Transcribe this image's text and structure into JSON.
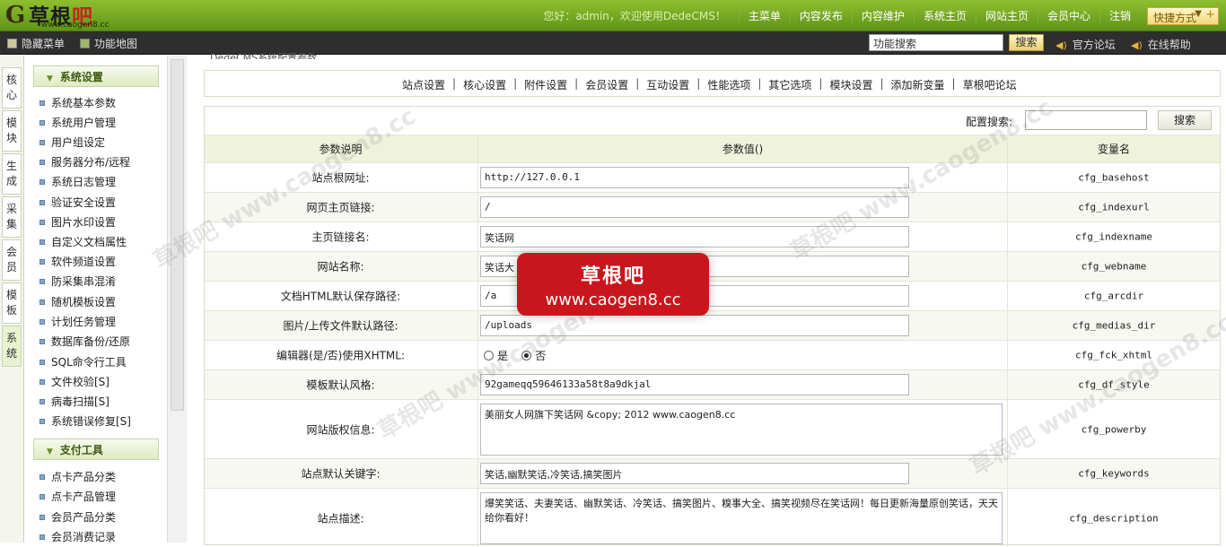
{
  "topbar": {
    "logo_name": "草根",
    "logo_name_red": "吧",
    "logo_url": "www.caogen8.cc",
    "welcome": "您好：admin，欢迎使用DedeCMS！",
    "links": [
      "主菜单",
      "内容发布",
      "内容维护",
      "系统主页",
      "网站主页",
      "会员中心",
      "注销"
    ],
    "quick_label": "快捷方式"
  },
  "subbar": {
    "hide_menu": "隐藏菜单",
    "function_map": "功能地图",
    "search_value": "功能搜索",
    "search_button": "搜索",
    "official_forum": "官方论坛",
    "online_help": "在线帮助"
  },
  "vtabs": [
    "核心",
    "模块",
    "生成",
    "采集",
    "会员",
    "模板",
    "系统"
  ],
  "leftmenu": {
    "group1": "系统设置",
    "group1_items": [
      "系统基本参数",
      "系统用户管理",
      "用户组设定",
      "服务器分布/远程",
      "系统日志管理",
      "验证安全设置",
      "图片水印设置",
      "自定义文档属性",
      "软件频道设置",
      "防采集串混淆",
      "随机模板设置",
      "计划任务管理",
      "数据库备份/还原",
      "SQL命令行工具",
      "文件校验[S]",
      "病毒扫描[S]",
      "系统错误修复[S]"
    ],
    "group2": "支付工具",
    "group2_items": [
      "点卡产品分类",
      "点卡产品管理",
      "会员产品分类",
      "会员消费记录"
    ]
  },
  "main": {
    "cut_title": "DedeCMS系统配置参数",
    "tabs": [
      "站点设置",
      "核心设置",
      "附件设置",
      "会员设置",
      "互动设置",
      "性能选项",
      "其它选项",
      "模块设置",
      "添加新变量",
      "草根吧论坛"
    ],
    "config_search_label": "配置搜索:",
    "config_search_button": "搜索",
    "headers": [
      "参数说明",
      "参数值()",
      "变量名"
    ],
    "rows": [
      {
        "label": "站点根网址:",
        "value": "http://127.0.0.1",
        "var": "cfg_basehost"
      },
      {
        "label": "网页主页链接:",
        "value": "/",
        "var": "cfg_indexurl"
      },
      {
        "label": "主页链接名:",
        "value": "笑话网",
        "var": "cfg_indexname"
      },
      {
        "label": "网站名称:",
        "value": "笑话大",
        "var": "cfg_webname"
      },
      {
        "label": "文档HTML默认保存路径:",
        "value": "/a",
        "var": "cfg_arcdir"
      },
      {
        "label": "图片/上传文件默认路径:",
        "value": "/uploads",
        "var": "cfg_medias_dir"
      },
      {
        "label": "编辑器(是/否)使用XHTML:",
        "radio_yes": "是",
        "radio_no": "否",
        "var": "cfg_fck_xhtml"
      },
      {
        "label": "模板默认风格:",
        "value": "92gameqq59646133a58t8a9dkjal",
        "var": "cfg_df_style"
      },
      {
        "label": "网站版权信息:",
        "value": "美丽女人网旗下笑话网  &copy; 2012 www.caogen8.cc",
        "var": "cfg_powerby"
      },
      {
        "label": "站点默认关键字:",
        "value": "笑话,幽默笑话,冷笑话,搞笑图片",
        "var": "cfg_keywords"
      },
      {
        "label": "站点描述:",
        "value": "爆笑笑话、夫妻笑话、幽默笑话、冷笑话、搞笑图片、糗事大全、搞笑视频尽在笑话网！每日更新海量原创笑话，天天给你看好！",
        "var": "cfg_description"
      }
    ]
  },
  "watermark": {
    "title": "草根吧",
    "url": "www.caogen8.cc"
  }
}
